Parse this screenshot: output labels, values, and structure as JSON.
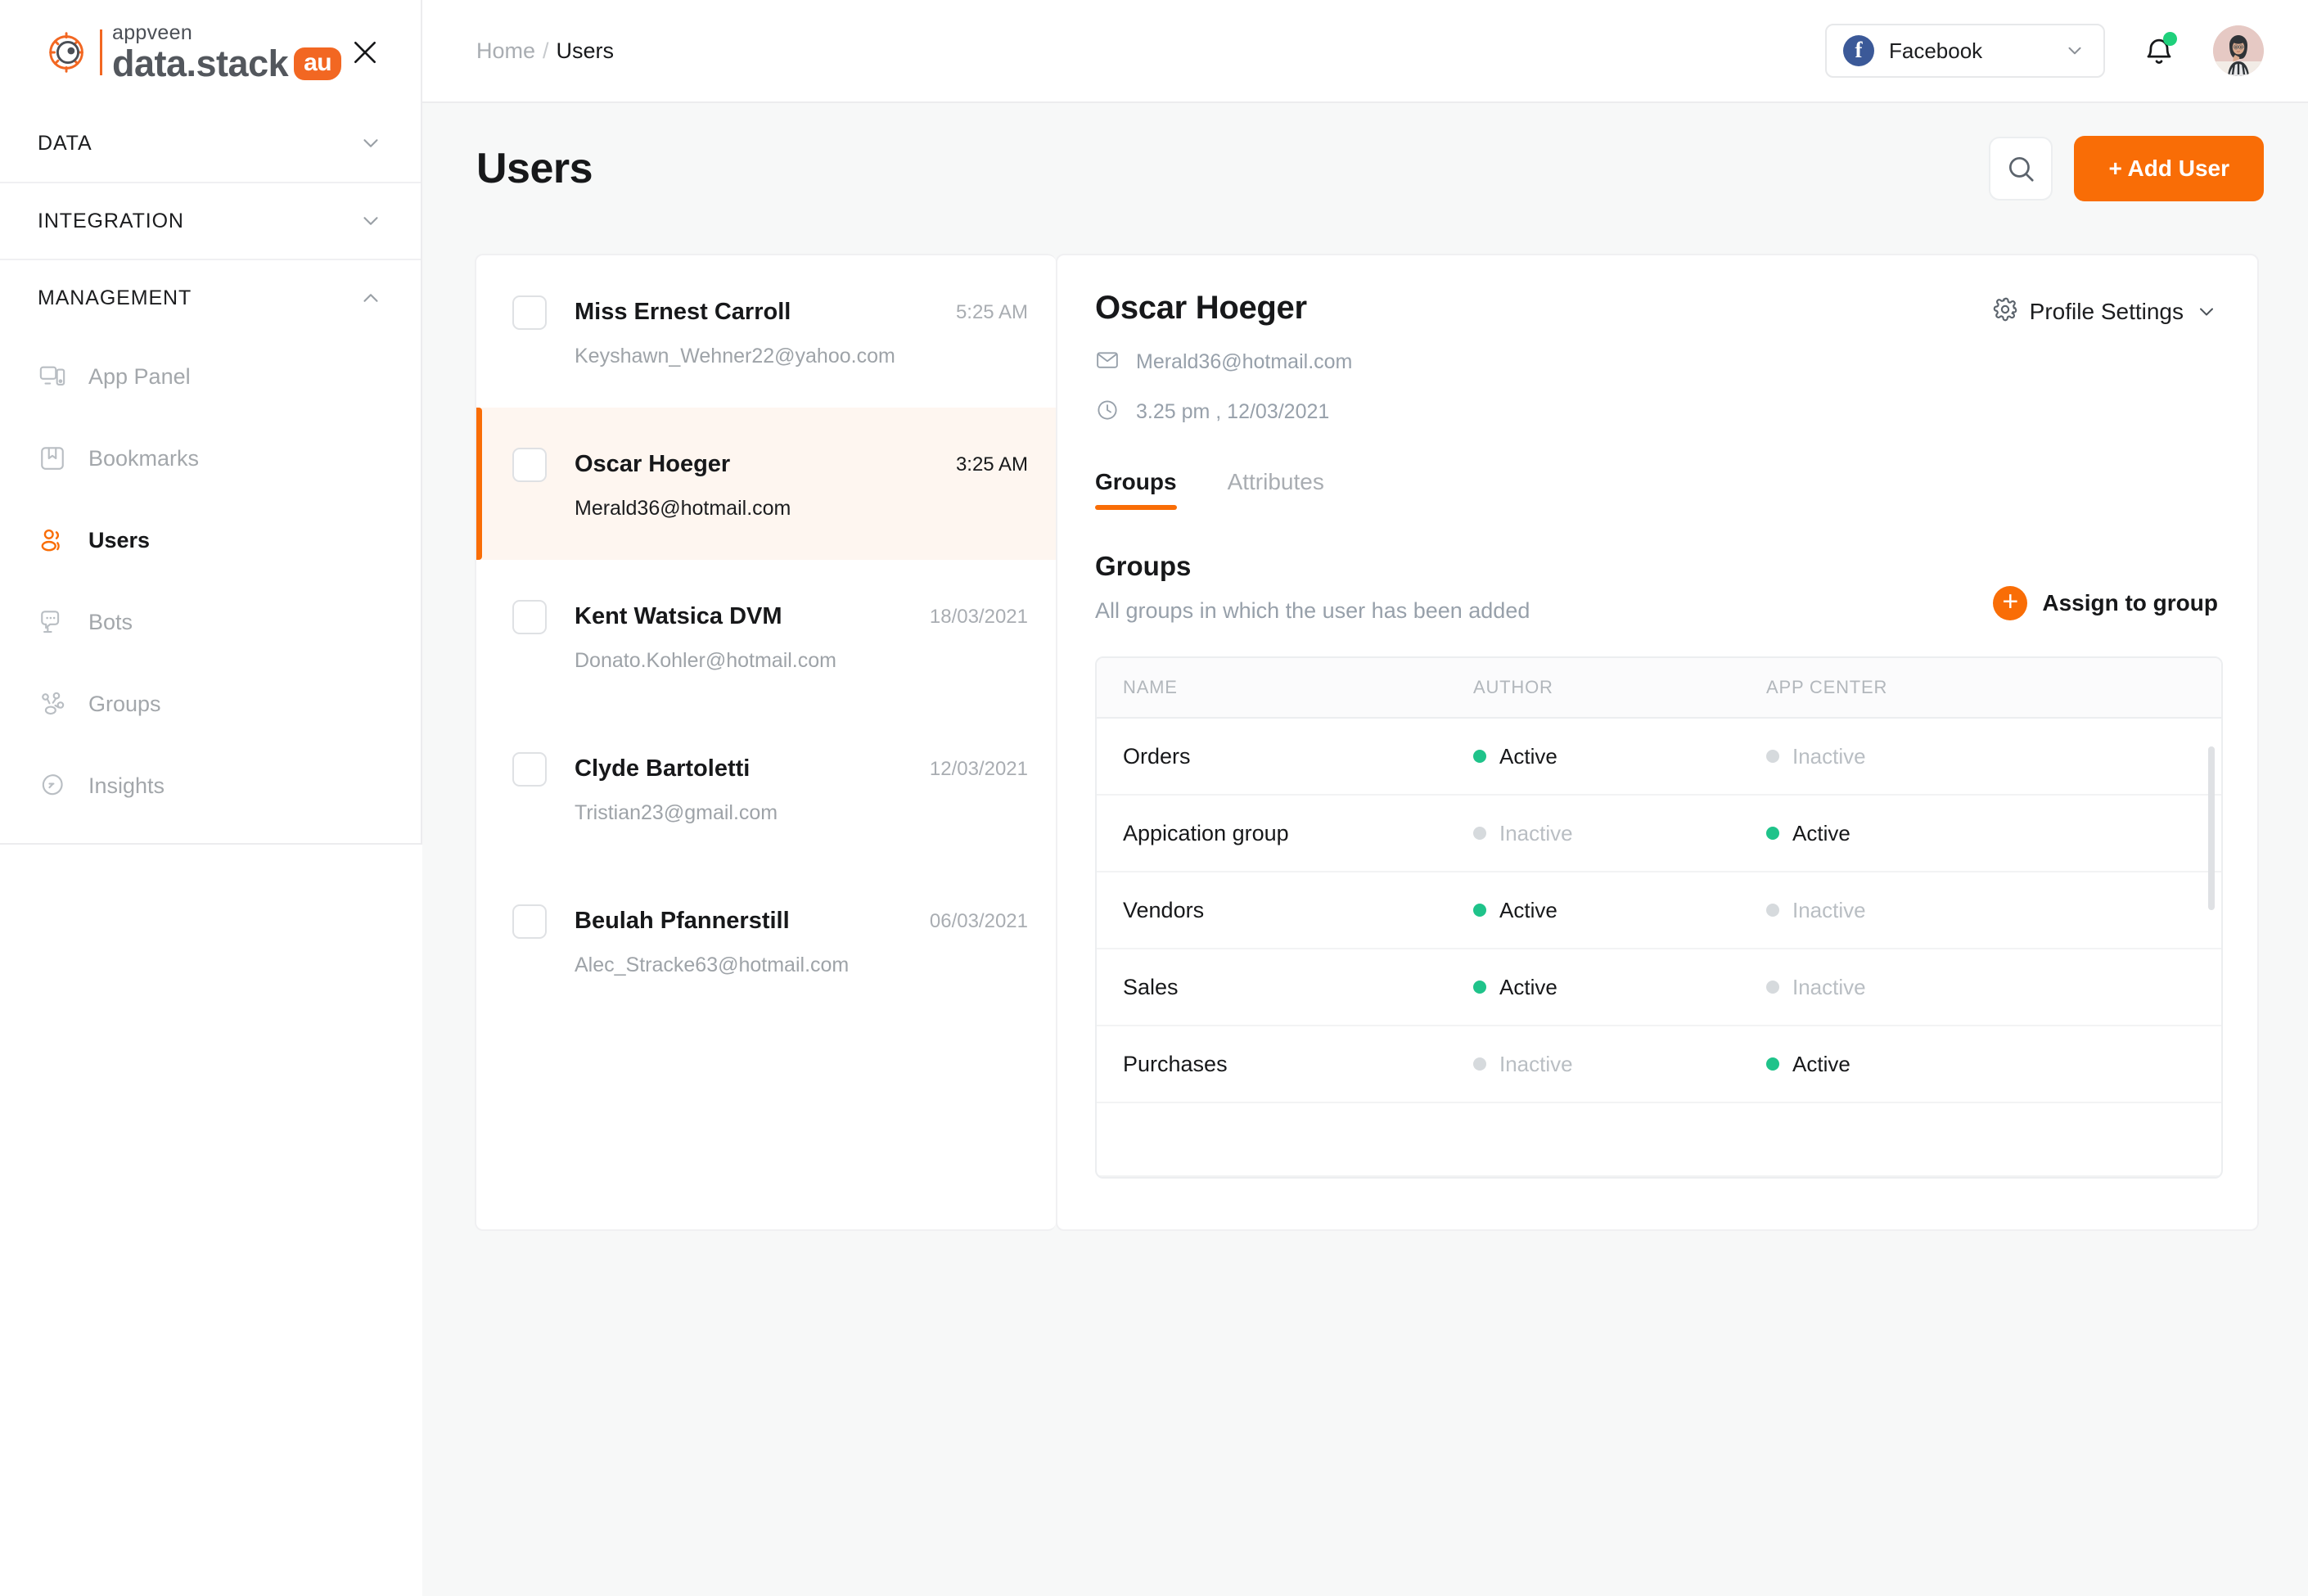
{
  "brand": {
    "appveen": "appveen",
    "name": "data.stack",
    "badge": "au",
    "close_icon": "close-icon"
  },
  "sidebar": {
    "sections": [
      {
        "label": "DATA",
        "expanded": false
      },
      {
        "label": "INTEGRATION",
        "expanded": false
      },
      {
        "label": "MANAGEMENT",
        "expanded": true
      }
    ],
    "items": [
      {
        "label": "App Panel",
        "icon": "app-panel-icon",
        "active": false
      },
      {
        "label": "Bookmarks",
        "icon": "bookmark-icon",
        "active": false
      },
      {
        "label": "Users",
        "icon": "users-icon",
        "active": true
      },
      {
        "label": "Bots",
        "icon": "bot-icon",
        "active": false
      },
      {
        "label": "Groups",
        "icon": "groups-icon",
        "active": false
      },
      {
        "label": "Insights",
        "icon": "insights-icon",
        "active": false
      }
    ]
  },
  "topbar": {
    "breadcrumb_home": "Home",
    "breadcrumb_sep": "/",
    "breadcrumb_current": "Users",
    "app_selector": {
      "label": "Facebook",
      "icon": "facebook-icon",
      "chevron": "chevron-down-icon"
    },
    "bell_icon": "notification-bell-icon",
    "avatar": "user-avatar"
  },
  "page": {
    "title": "Users",
    "search_icon": "search-icon",
    "add_user_label": "+ Add User"
  },
  "user_list": [
    {
      "name": "Miss Ernest Carroll",
      "email": "Keyshawn_Wehner22@yahoo.com",
      "time": "5:25 AM",
      "selected": false
    },
    {
      "name": "Oscar Hoeger",
      "email": "Merald36@hotmail.com",
      "time": "3:25 AM",
      "selected": true
    },
    {
      "name": "Kent Watsica DVM",
      "email": "Donato.Kohler@hotmail.com",
      "time": "18/03/2021",
      "selected": false
    },
    {
      "name": "Clyde Bartoletti",
      "email": "Tristian23@gmail.com",
      "time": "12/03/2021",
      "selected": false
    },
    {
      "name": "Beulah Pfannerstill",
      "email": "Alec_Stracke63@hotmail.com",
      "time": "06/03/2021",
      "selected": false
    }
  ],
  "detail": {
    "name": "Oscar Hoeger",
    "email": "Merald36@hotmail.com",
    "email_icon": "mail-icon",
    "timestamp": "3.25 pm , 12/03/2021",
    "clock_icon": "clock-icon",
    "profile_settings_label": "Profile Settings",
    "gear_icon": "gear-icon",
    "chevron_icon": "chevron-down-icon",
    "tabs": [
      {
        "label": "Groups",
        "active": true
      },
      {
        "label": "Attributes",
        "active": false
      }
    ],
    "groups_title": "Groups",
    "groups_subtitle": "All groups in which the user has been added",
    "assign_label": "Assign to group",
    "assign_icon": "plus-circle-icon"
  },
  "groups_table": {
    "columns": [
      "NAME",
      "AUTHOR",
      "APP CENTER"
    ],
    "rows": [
      {
        "name": "Orders",
        "author": "Active",
        "author_on": true,
        "app_center": "Inactive",
        "app_center_on": false
      },
      {
        "name": "Appication group",
        "author": "Inactive",
        "author_on": false,
        "app_center": "Active",
        "app_center_on": true
      },
      {
        "name": "Vendors",
        "author": "Active",
        "author_on": true,
        "app_center": "Inactive",
        "app_center_on": false
      },
      {
        "name": "Sales",
        "author": "Active",
        "author_on": true,
        "app_center": "Inactive",
        "app_center_on": false
      },
      {
        "name": "Purchases",
        "author": "Inactive",
        "author_on": false,
        "app_center": "Active",
        "app_center_on": true
      }
    ]
  },
  "colors": {
    "accent": "#f96d06",
    "brand_orange": "#f26722",
    "active_green": "#1fc38a",
    "notification_green": "#1fd07b",
    "facebook_blue": "#3b5998",
    "page_bg": "#f7f8f8",
    "selected_row_bg": "#fef6f0"
  }
}
